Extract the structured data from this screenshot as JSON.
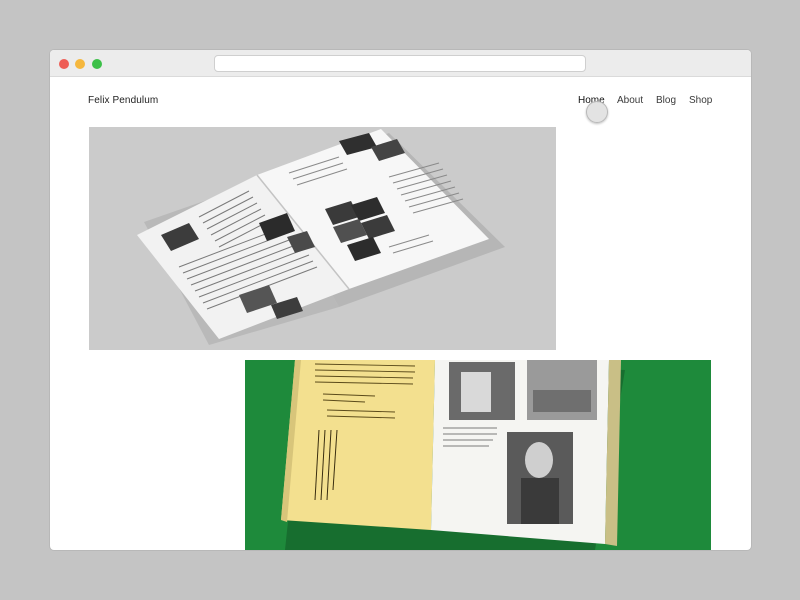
{
  "site": {
    "logo": "Felix Pendulum"
  },
  "nav": [
    {
      "label": "Home",
      "active": true
    },
    {
      "label": "About",
      "active": false
    },
    {
      "label": "Blog",
      "active": false
    },
    {
      "label": "Shop",
      "active": false
    }
  ],
  "browser": {
    "url": ""
  },
  "gallery": [
    {
      "description": "open magazine with black-and-white photographs on grey background",
      "bg": "#cbcbcb"
    },
    {
      "description": "open book with yellow page and vintage portrait photos on green background",
      "bg": "#1e8a3b"
    }
  ],
  "colors": {
    "close": "#ee5d55",
    "minimize": "#f5b73d",
    "maximize": "#3cc048",
    "photo2_background": "#1e8a3b",
    "book_yellow_page": "#f3e08f"
  }
}
